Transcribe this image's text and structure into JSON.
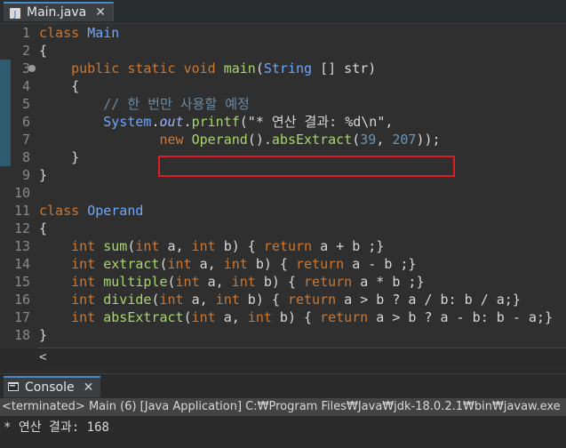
{
  "editor": {
    "tab": {
      "title": "Main.java",
      "close": "✕"
    },
    "line_numbers": [
      "1",
      "2",
      "3",
      "4",
      "5",
      "6",
      "7",
      "8",
      "9",
      "10",
      "11",
      "12",
      "13",
      "14",
      "15",
      "16",
      "17",
      "18"
    ],
    "lines": [
      [
        {
          "t": "class ",
          "c": "kw"
        },
        {
          "t": "Main",
          "c": "type"
        }
      ],
      [
        {
          "t": "{",
          "c": "punc"
        }
      ],
      [
        {
          "t": "    "
        },
        {
          "t": "public",
          "c": "kw"
        },
        {
          "t": " "
        },
        {
          "t": "static",
          "c": "kw"
        },
        {
          "t": " "
        },
        {
          "t": "void",
          "c": "kw"
        },
        {
          "t": " "
        },
        {
          "t": "main",
          "c": "fn"
        },
        {
          "t": "("
        },
        {
          "t": "String",
          "c": "type"
        },
        {
          "t": " [] str)"
        }
      ],
      [
        {
          "t": "    {"
        }
      ],
      [
        {
          "t": "        "
        },
        {
          "t": "// 한 번만 사용할 예정",
          "c": "comment"
        }
      ],
      [
        {
          "t": "        "
        },
        {
          "t": "System",
          "c": "type"
        },
        {
          "t": "."
        },
        {
          "t": "out",
          "c": "field"
        },
        {
          "t": "."
        },
        {
          "t": "printf",
          "c": "fn"
        },
        {
          "t": "(\"* 연산 결과: %d\\n\",",
          "c": "str"
        }
      ],
      [
        {
          "t": "               "
        },
        {
          "t": "new",
          "c": "kw"
        },
        {
          "t": " "
        },
        {
          "t": "Operand",
          "c": "fn"
        },
        {
          "t": "()."
        },
        {
          "t": "absExtract",
          "c": "fn"
        },
        {
          "t": "("
        },
        {
          "t": "39",
          "c": "num"
        },
        {
          "t": ", "
        },
        {
          "t": "207",
          "c": "num"
        },
        {
          "t": "));"
        }
      ],
      [
        {
          "t": "    }"
        }
      ],
      [
        {
          "t": "}"
        }
      ],
      [
        {
          "t": ""
        }
      ],
      [
        {
          "t": "class ",
          "c": "kw"
        },
        {
          "t": "Operand",
          "c": "type"
        }
      ],
      [
        {
          "t": "{"
        }
      ],
      [
        {
          "t": "    "
        },
        {
          "t": "int",
          "c": "kw"
        },
        {
          "t": " "
        },
        {
          "t": "sum",
          "c": "fn"
        },
        {
          "t": "("
        },
        {
          "t": "int",
          "c": "kw"
        },
        {
          "t": " a, "
        },
        {
          "t": "int",
          "c": "kw"
        },
        {
          "t": " b) { "
        },
        {
          "t": "return",
          "c": "kw"
        },
        {
          "t": " a + b ;}"
        }
      ],
      [
        {
          "t": "    "
        },
        {
          "t": "int",
          "c": "kw"
        },
        {
          "t": " "
        },
        {
          "t": "extract",
          "c": "fn"
        },
        {
          "t": "("
        },
        {
          "t": "int",
          "c": "kw"
        },
        {
          "t": " a, "
        },
        {
          "t": "int",
          "c": "kw"
        },
        {
          "t": " b) { "
        },
        {
          "t": "return",
          "c": "kw"
        },
        {
          "t": " a - b ;}"
        }
      ],
      [
        {
          "t": "    "
        },
        {
          "t": "int",
          "c": "kw"
        },
        {
          "t": " "
        },
        {
          "t": "multiple",
          "c": "fn"
        },
        {
          "t": "("
        },
        {
          "t": "int",
          "c": "kw"
        },
        {
          "t": " a, "
        },
        {
          "t": "int",
          "c": "kw"
        },
        {
          "t": " b) { "
        },
        {
          "t": "return",
          "c": "kw"
        },
        {
          "t": " a * b ;}"
        }
      ],
      [
        {
          "t": "    "
        },
        {
          "t": "int",
          "c": "kw"
        },
        {
          "t": " "
        },
        {
          "t": "divide",
          "c": "fn"
        },
        {
          "t": "("
        },
        {
          "t": "int",
          "c": "kw"
        },
        {
          "t": " a, "
        },
        {
          "t": "int",
          "c": "kw"
        },
        {
          "t": " b) { "
        },
        {
          "t": "return",
          "c": "kw"
        },
        {
          "t": " a > b ? a / b: b / a;}"
        }
      ],
      [
        {
          "t": "    "
        },
        {
          "t": "int",
          "c": "kw"
        },
        {
          "t": " "
        },
        {
          "t": "absExtract",
          "c": "fn"
        },
        {
          "t": "("
        },
        {
          "t": "int",
          "c": "kw"
        },
        {
          "t": " a, "
        },
        {
          "t": "int",
          "c": "kw"
        },
        {
          "t": " b) { "
        },
        {
          "t": "return",
          "c": "kw"
        },
        {
          "t": " a > b ? a - b: b - a;}"
        }
      ],
      [
        {
          "t": "}"
        }
      ]
    ],
    "fold_marker_line": "3",
    "scroll_left_arrow": "<"
  },
  "console": {
    "tab_title": "Console",
    "close": "✕",
    "header": "<terminated> Main (6) [Java Application] C:₩Program Files₩Java₩jdk-18.0.2.1₩bin₩javaw.exe",
    "output": "* 연산 결과: 168"
  },
  "colors": {
    "keyword": "#cc7832",
    "type": "#6ea7ff",
    "method": "#a9d66e",
    "number": "#6897bb",
    "comment": "#6b8ba3",
    "highlight_box": "#e01b24"
  }
}
